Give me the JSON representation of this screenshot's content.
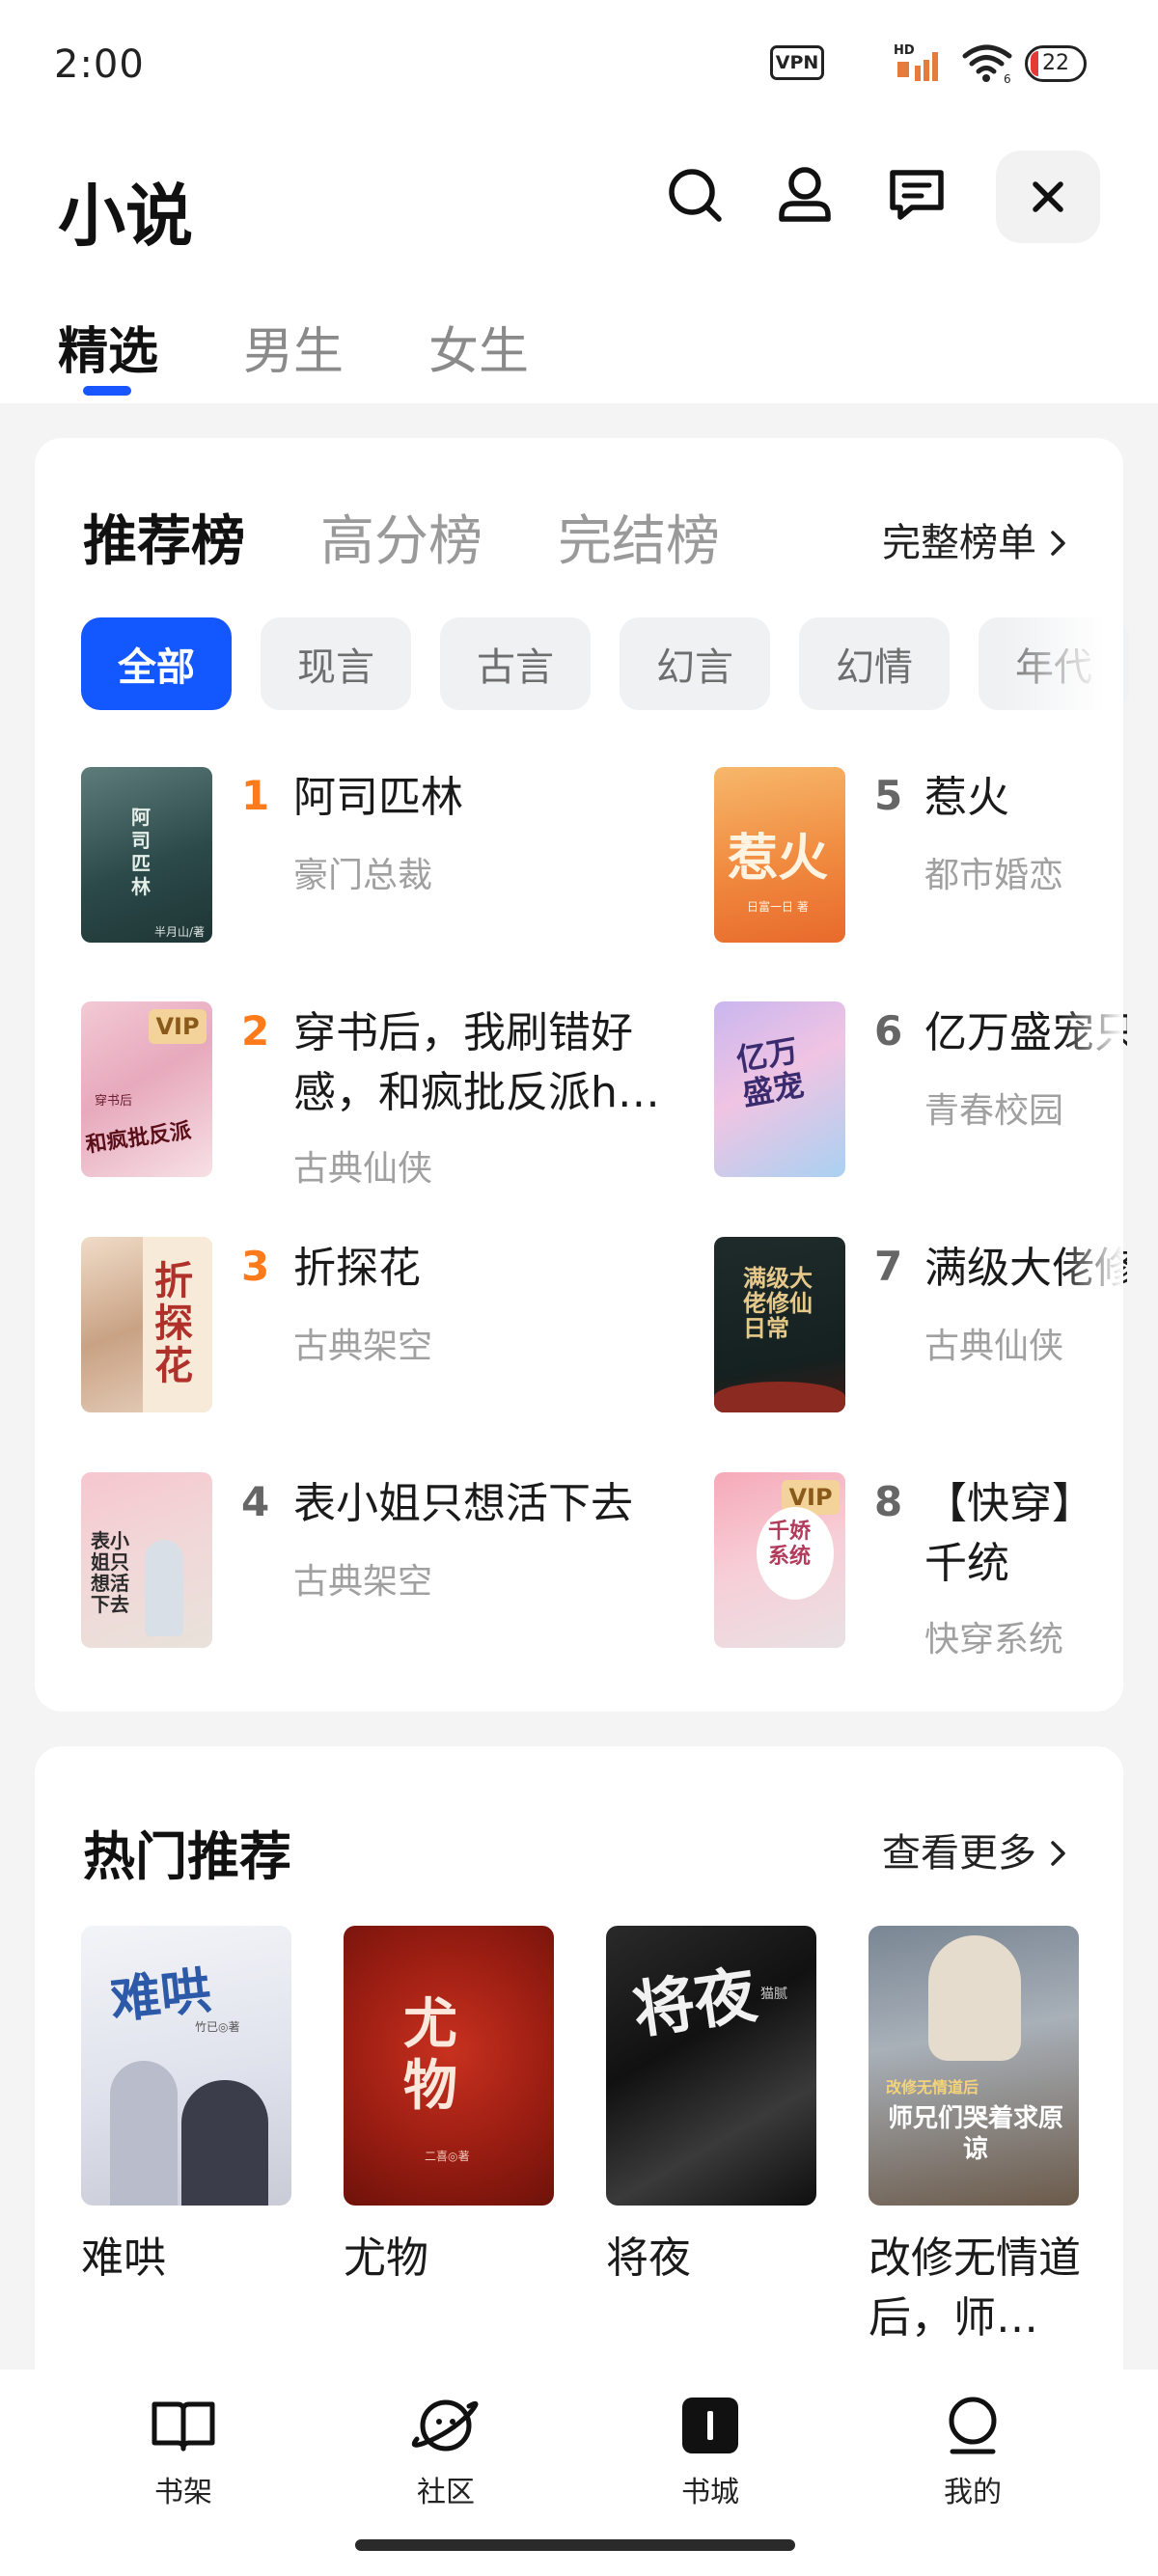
{
  "status": {
    "time": "2:00",
    "vpn": "VPN",
    "hd": "HD",
    "wifi_sub": "6",
    "battery": "22"
  },
  "header": {
    "title": "小说"
  },
  "tabs": [
    {
      "label": "精选",
      "active": true
    },
    {
      "label": "男生",
      "active": false
    },
    {
      "label": "女生",
      "active": false
    }
  ],
  "ranking": {
    "tabs": [
      {
        "label": "推荐榜",
        "active": true
      },
      {
        "label": "高分榜",
        "active": false
      },
      {
        "label": "完结榜",
        "active": false
      }
    ],
    "more_label": "完整榜单",
    "chips": [
      {
        "label": "全部",
        "active": true
      },
      {
        "label": "现言",
        "active": false
      },
      {
        "label": "古言",
        "active": false
      },
      {
        "label": "幻言",
        "active": false
      },
      {
        "label": "幻情",
        "active": false
      },
      {
        "label": "年代",
        "active": false
      }
    ],
    "items": [
      {
        "rank": "1",
        "title": "阿司匹林",
        "genre": "豪门总裁",
        "cover_text": "阿司匹林",
        "cover_sub": "半月山/著",
        "vip": false
      },
      {
        "rank": "2",
        "title": "穿书后，我刷错好感，和疯批反派h…",
        "genre": "古典仙侠",
        "cover_text": "和疯批反派",
        "cover_sub": "穿书后",
        "vip": true,
        "vip_label": "VIP"
      },
      {
        "rank": "3",
        "title": "折探花",
        "genre": "古典架空",
        "cover_text": "折探花",
        "vip": false
      },
      {
        "rank": "4",
        "title": "表小姐只想活下去",
        "genre": "古典架空",
        "cover_text": "表小姐只想活下去",
        "vip": false
      },
      {
        "rank": "5",
        "title": "惹火",
        "genre": "都市婚恋",
        "cover_text": "惹火",
        "cover_sub": "日富一日 著",
        "vip": false
      },
      {
        "rank": "6",
        "title": "亿万盛宠只",
        "genre": "青春校园",
        "cover_text": "亿万盛宠",
        "vip": false
      },
      {
        "rank": "7",
        "title": "满级大佬修",
        "genre": "古典仙侠",
        "cover_text": "满级大佬修仙日常",
        "vip": false
      },
      {
        "rank": "8",
        "title": "【快穿】千统",
        "genre": "快穿系统",
        "cover_text": "千娇系统",
        "vip": true,
        "vip_label": "VIP"
      }
    ]
  },
  "hot": {
    "title": "热门推荐",
    "more_label": "查看更多",
    "items": [
      {
        "name": "难哄",
        "cover_text": "难哄",
        "cover_sub": "竹已◎著"
      },
      {
        "name": "尤物",
        "cover_text": "尤物",
        "cover_sub": "二喜◎著"
      },
      {
        "name": "将夜",
        "cover_text": "将夜",
        "cover_sub": "猫腻"
      },
      {
        "name": "改修无情道后，师…",
        "cover_text": "师兄们哭着求原谅",
        "cover_sub": "改修无情道后"
      }
    ]
  },
  "nav": [
    {
      "label": "书架",
      "icon": "book-icon"
    },
    {
      "label": "社区",
      "icon": "planet-icon"
    },
    {
      "label": "书城",
      "icon": "store-icon"
    },
    {
      "label": "我的",
      "icon": "profile-icon"
    }
  ],
  "colors": {
    "accent": "#1257ff",
    "rank_top": "#ff7a1a",
    "vip": "#f3d39a"
  }
}
